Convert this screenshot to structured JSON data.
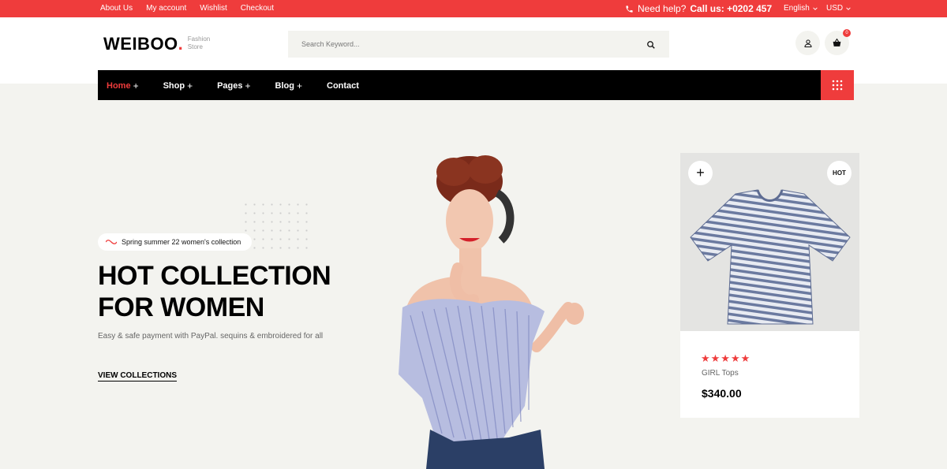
{
  "topbar": {
    "links": [
      "About Us",
      "My account",
      "Wishlist",
      "Checkout"
    ],
    "help_text": "Need help?",
    "help_phone": "Call us: +0202 457",
    "language": "English",
    "currency": "USD"
  },
  "header": {
    "logo": "WEIBOO",
    "logo_dot": ".",
    "logo_tag_1": "Fashion",
    "logo_tag_2": "Store",
    "search_placeholder": "Search Keyword...",
    "cart_count": "0"
  },
  "nav": {
    "items": [
      {
        "label": "Home",
        "plus": "+"
      },
      {
        "label": "Shop",
        "plus": "+"
      },
      {
        "label": "Pages",
        "plus": "+"
      },
      {
        "label": "Blog",
        "plus": "+"
      },
      {
        "label": "Contact",
        "plus": ""
      }
    ]
  },
  "hero": {
    "pill_text": "Spring summer 22 women's collection",
    "title_line1": "HOT COLLECTION",
    "title_line2": "FOR WOMEN",
    "description": "Easy & safe payment with PayPal. sequins & embroidered for all",
    "cta": "VIEW COLLECTIONS"
  },
  "product": {
    "badge": "HOT",
    "add_symbol": "+",
    "rating": 5,
    "stars": "★★★★★",
    "name": "GIRL Tops",
    "price": "$340.00"
  },
  "colors": {
    "accent": "#ef3c3c",
    "nav_bg": "#000000",
    "page_bg": "#f3f3ef"
  }
}
